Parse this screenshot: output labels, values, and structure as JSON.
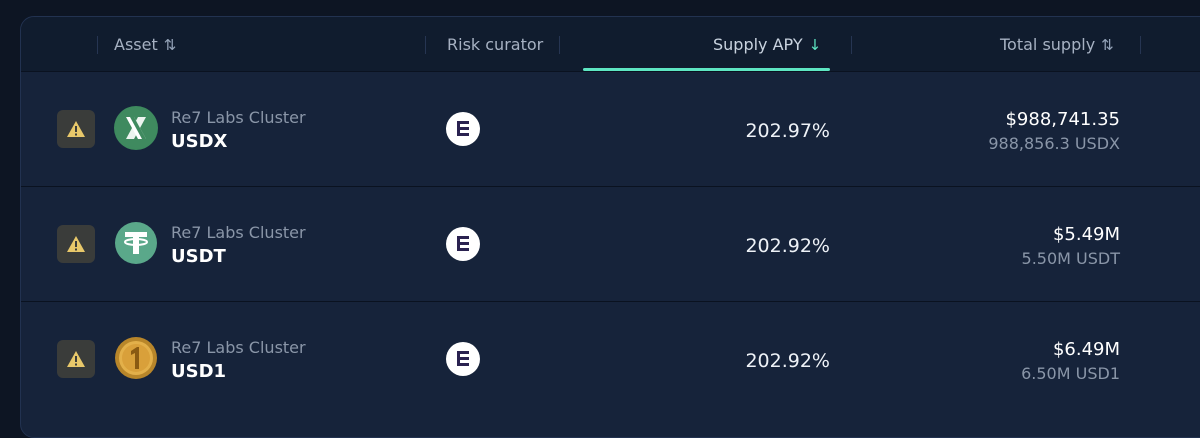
{
  "header": {
    "asset": "Asset",
    "risk_curator": "Risk curator",
    "supply_apy": "Supply APY",
    "total_supply": "Total supply"
  },
  "icons": {
    "sort": "sort-icon",
    "sort_desc": "arrow-down-icon",
    "warning": "warning-icon",
    "curator": "re7-curator-icon"
  },
  "colors": {
    "accent": "#5ee6c2",
    "row_bg": "#16233a",
    "header_bg": "#101c2e",
    "warning": "#e8c86a"
  },
  "rows": [
    {
      "cluster": "Re7 Labs Cluster",
      "symbol": "USDX",
      "token_icon": "usdx-icon",
      "apy": "202.97%",
      "total_usd": "$988,741.35",
      "total_amount": "988,856.3 USDX"
    },
    {
      "cluster": "Re7 Labs Cluster",
      "symbol": "USDT",
      "token_icon": "usdt-icon",
      "apy": "202.92%",
      "total_usd": "$5.49M",
      "total_amount": "5.50M USDT"
    },
    {
      "cluster": "Re7 Labs Cluster",
      "symbol": "USD1",
      "token_icon": "usd1-icon",
      "apy": "202.92%",
      "total_usd": "$6.49M",
      "total_amount": "6.50M USD1"
    }
  ]
}
